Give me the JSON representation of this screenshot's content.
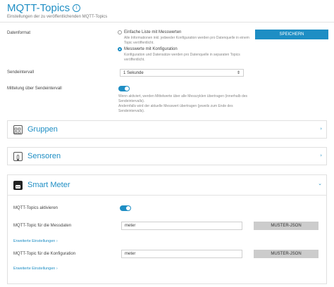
{
  "header": {
    "title": "MQTT-Topics",
    "subtitle": "Einstellungen der zu veröffentlichenden MQTT-Topics"
  },
  "datenformat": {
    "label": "Datenformat",
    "option1_label": "Einfache Liste mit Messwerten",
    "option1_desc": "Alle Informationen inkl. jedweder Konfiguration werden pro Datenquelle in einem Topic veröffentlicht.",
    "option2_label": "Messwerte mit Konfiguration",
    "option2_desc": "Konfiguration und Datensätze werden pro Datenquelle in separaten Topics veröffentlicht.",
    "selected": 2
  },
  "save_button": "SPEICHERN",
  "sendeintervall": {
    "label": "Sendeintervall",
    "value": "1 Sekunde"
  },
  "mittelung": {
    "label": "Mittelung über Sendeintervall",
    "enabled": true,
    "desc1": "Wenn aktiviert, werden Mittelwerte über alle Messzyklen übertragen (innerhalb des Sendeintervalls).",
    "desc2": "Andernfalls wird der aktuelle Messwert übertragen (jeweils zum Ende des Sendeintervalls)."
  },
  "panels": {
    "gruppen": "Gruppen",
    "sensoren": "Sensoren",
    "smart_meter": "Smart Meter"
  },
  "smart_meter": {
    "aktivieren_label": "MQTT-Topics aktivieren",
    "aktiviert": true,
    "messdaten_label": "MQTT-Topic für die Messdaten",
    "messdaten_value": "meter",
    "konfig_label": "MQTT-Topic für die Konfiguration",
    "konfig_value": "meter",
    "muster_button": "MUSTER-JSON",
    "erweiterte_link": "Erweiterte Einstellungen ›"
  },
  "colors": {
    "accent": "#1e8ec4",
    "button_gray": "#cccccc"
  }
}
